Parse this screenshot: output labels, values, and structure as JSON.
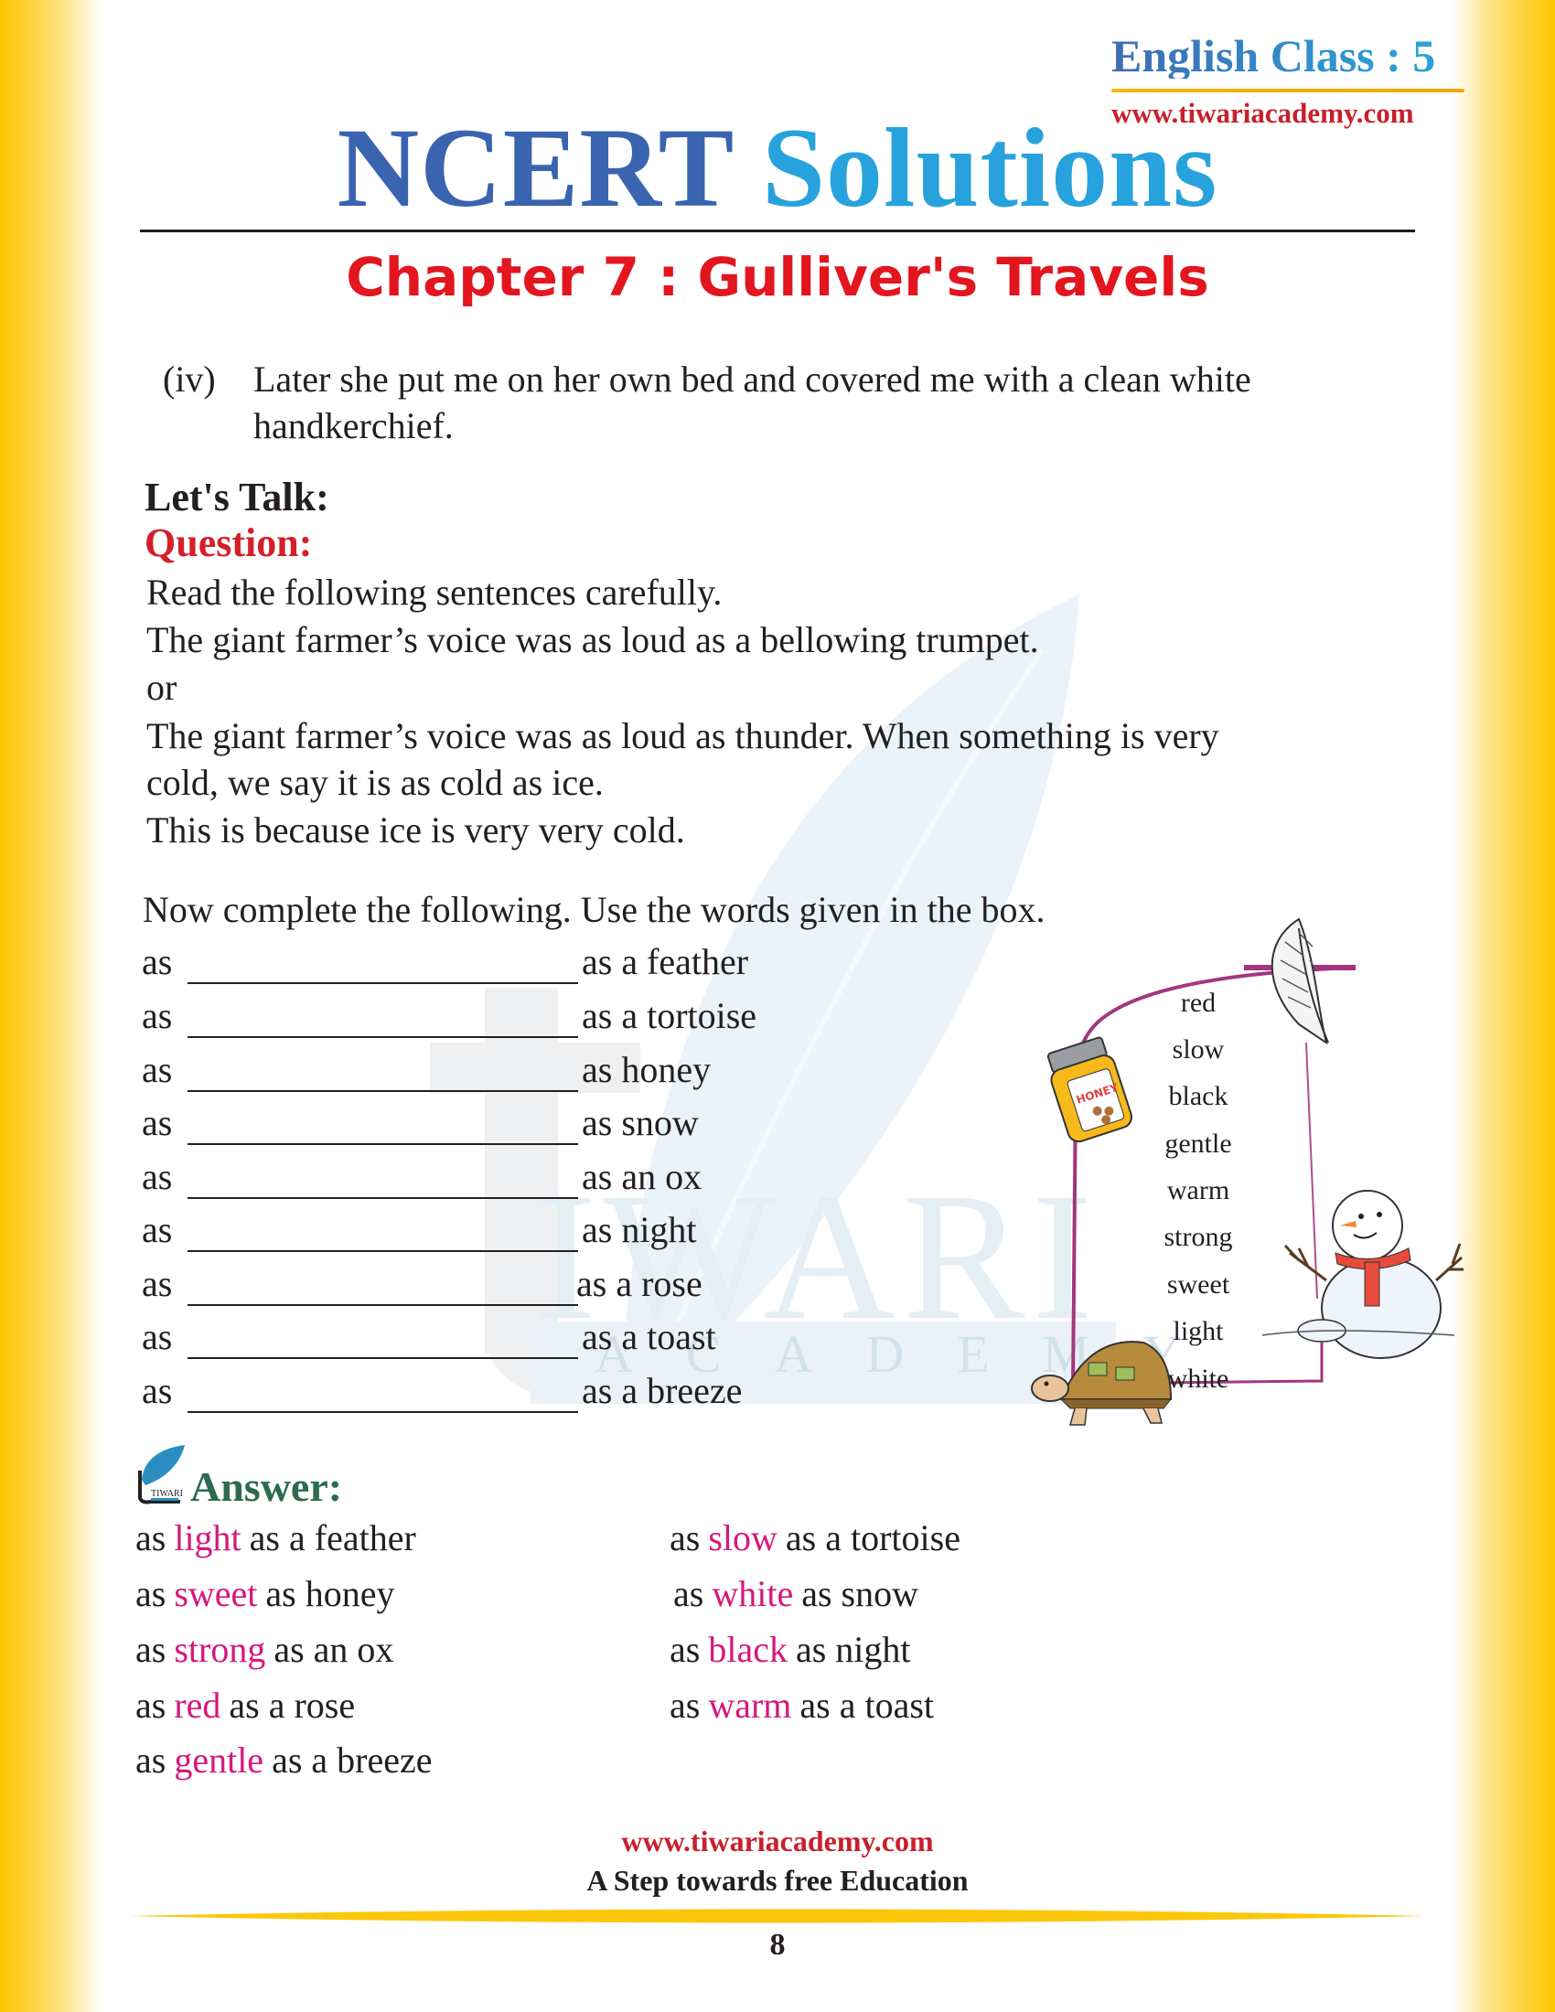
{
  "header": {
    "class_label": "English Class : 5",
    "site_url": "www.tiwariacademy.com",
    "title_part1": "NCERT",
    "title_part2": "Solutions",
    "chapter": "Chapter 7 : Gulliver's Travels"
  },
  "watermark": {
    "brand": "IWARI",
    "sub": "ACADEMY"
  },
  "previous_item": {
    "numeral": "(iv)",
    "line1": "Later she put me on her own bed and covered me with a clean white",
    "line2": "handkerchief."
  },
  "lets_talk": {
    "heading": "Let's Talk:",
    "question_label": "Question:",
    "paragraph": [
      "Read the following sentences carefully.",
      "The giant farmer’s voice was as loud as a bellowing trumpet.",
      "or",
      "The giant farmer’s voice was as loud as thunder. When something is very",
      "cold, we say it is as cold as ice.",
      "This is because ice is very very cold."
    ],
    "instruction": "Now complete the following. Use the words given in the box.",
    "fill_prefix": "as",
    "fill_rows": [
      "as a feather",
      "as a tortoise",
      "as honey",
      "as snow",
      "as an ox",
      "as night",
      "as a rose",
      "as a toast",
      "as a breeze"
    ],
    "word_box": [
      "red",
      "slow",
      "black",
      "gentle",
      "warm",
      "strong",
      "sweet",
      "light",
      "white"
    ],
    "box_border_color": "#a3367f"
  },
  "answer": {
    "heading": "Answer:",
    "logo_text": "TIWARI",
    "highlight_color": "#d6177d",
    "left_column": [
      {
        "pre": "as",
        "word": "light",
        "post": "as a feather"
      },
      {
        "pre": "as",
        "word": "sweet",
        "post": "as honey"
      },
      {
        "pre": "as",
        "word": "strong",
        "post": "as an ox"
      },
      {
        "pre": "as",
        "word": "red",
        "post": "as a rose"
      },
      {
        "pre": "as",
        "word": "gentle",
        "post": "as a breeze"
      }
    ],
    "right_column": [
      {
        "pre": "as",
        "word": "slow",
        "post": "as a tortoise"
      },
      {
        "pre": "as",
        "word": "white",
        "post": "as snow"
      },
      {
        "pre": "as",
        "word": "black",
        "post": "as night"
      },
      {
        "pre": "as",
        "word": "warm",
        "post": "as a toast"
      }
    ]
  },
  "footer": {
    "url": "www.tiwariacademy.com",
    "tagline": "A Step towards free Education",
    "page_number": "8"
  },
  "colors": {
    "title_dark_blue": "#3a64b0",
    "title_light_blue": "#27a2dc",
    "chapter_red": "#e3151f",
    "question_red": "#d4202a",
    "answer_green": "#2d6a4f",
    "side_yellow": "#fdc800"
  }
}
